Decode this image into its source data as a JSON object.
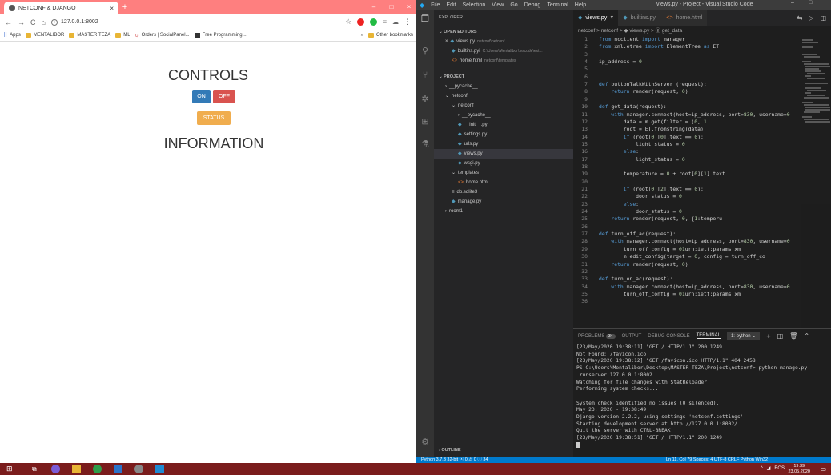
{
  "browser": {
    "tab_title": "NETCONF & DJANGO",
    "url": "127.0.0.1:8002",
    "bookmarks": [
      "Apps",
      "MENTALIBOR",
      "MASTER TEZA",
      "ML",
      "Orders | SocialPanel...",
      "Free Programming..."
    ],
    "bookmarks_more": "»",
    "other_bookmarks": "Other bookmarks",
    "page": {
      "controls_heading": "CONTROLS",
      "on_label": "ON",
      "off_label": "OFF",
      "status_label": "STATUS",
      "info_heading": "INFORMATION"
    }
  },
  "vscode": {
    "menu": [
      "File",
      "Edit",
      "Selection",
      "View",
      "Go",
      "Debug",
      "Terminal",
      "Help"
    ],
    "window_title": "views.py - Project - Visual Studio Code",
    "explorer_title": "EXPLORER",
    "open_editors_title": "OPEN EDITORS",
    "open_editors": [
      {
        "name": "views.py",
        "path": "netconf\\netconf"
      },
      {
        "name": "builtins.pyi",
        "path": "C:\\Users\\Mentalibor\\.vscode\\ext..."
      },
      {
        "name": "home.html",
        "path": "netconf\\templates"
      }
    ],
    "project_title": "PROJECT",
    "tree": [
      "__pycache__",
      "netconf",
      "netconf",
      "__pycache__",
      "__init__.py",
      "settings.py",
      "urls.py",
      "views.py",
      "wsgi.py",
      "templates",
      "home.html",
      "db.sqlite3",
      "manage.py",
      "room1"
    ],
    "outline_title": "OUTLINE",
    "tabs": [
      "views.py",
      "builtins.pyi",
      "home.html"
    ],
    "breadcrumb": "netconf > netconf > ◆ views.py > ⓖ get_data",
    "code": [
      [
        "1",
        "from ncclient import manager"
      ],
      [
        "2",
        "from xml.etree import ElementTree as ET"
      ],
      [
        "3",
        ""
      ],
      [
        "4",
        "ip_address = '10.21.2.53'"
      ],
      [
        "5",
        ""
      ],
      [
        "6",
        ""
      ],
      [
        "7",
        "def buttonTalkWithServer (request):"
      ],
      [
        "8",
        "    return render(request, 'home.html')"
      ],
      [
        "9",
        ""
      ],
      [
        "10",
        "def get_data(request):"
      ],
      [
        "11",
        "    with manager.connect(host=ip_address, port=830, username='"
      ],
      [
        "12",
        "        data = m.get(filter = (\"subtree\", \"<room-data></room-d"
      ],
      [
        "13",
        "        root = ET.fromstring(data)"
      ],
      [
        "14",
        "        if (root[0][0].text == \"false\"):"
      ],
      [
        "15",
        "            light_status = \"Light Status: OFF\""
      ],
      [
        "16",
        "        else:"
      ],
      [
        "17",
        "            light_status = \"Light Status: ON\""
      ],
      [
        "18",
        ""
      ],
      [
        "19",
        "        temperature = \"Temperature: \" + root[0][1].text"
      ],
      [
        "20",
        ""
      ],
      [
        "21",
        "        if (root[0][2].text == \"false\"):"
      ],
      [
        "22",
        "            door_status = \"Door Status: CLOSED\""
      ],
      [
        "23",
        "        else:"
      ],
      [
        "24",
        "            door_status = \"Door Status: OPEN\""
      ],
      [
        "25",
        "    return render(request, 'home.html', {'temperature':temperu"
      ],
      [
        "26",
        ""
      ],
      [
        "27",
        "def turn_off_ac(request):"
      ],
      [
        "28",
        "    with manager.connect(host=ip_address, port=830, username='"
      ],
      [
        "29",
        "        turn_off_config = \"\"\"<config xmlns=\"urn:ietf:params:xm"
      ],
      [
        "30",
        "        m.edit_config(target = 'running', config = turn_off_co"
      ],
      [
        "31",
        "    return render(request, 'home.html')"
      ],
      [
        "32",
        ""
      ],
      [
        "33",
        "def turn_on_ac(request):"
      ],
      [
        "34",
        "    with manager.connect(host=ip_address, port=830, username='"
      ],
      [
        "35",
        "        turn_off_config = \"\"\"<config xmlns=\"urn:ietf:params:xm"
      ],
      [
        "36",
        ""
      ]
    ],
    "panel_tabs": [
      "PROBLEMS",
      "OUTPUT",
      "DEBUG CONSOLE",
      "TERMINAL"
    ],
    "problems_count": "34",
    "terminal_select": "1: python",
    "terminal": [
      "[23/May/2020 19:38:11] \"GET / HTTP/1.1\" 200 1249",
      "Not Found: /favicon.ico",
      "[23/May/2020 19:38:12] \"GET /favicon.ico HTTP/1.1\" 404 2458",
      "PS C:\\Users\\Mentalibor\\Desktop\\MASTER TEZA\\Project\\netconf> python manage.py",
      " runserver 127.0.0.1:8002",
      "Watching for file changes with StatReloader",
      "Performing system checks...",
      "",
      "System check identified no issues (0 silenced).",
      "May 23, 2020 - 19:38:49",
      "Django version 2.2.2, using settings 'netconf.settings'",
      "Starting development server at http://127.0.0.1:8002/",
      "Quit the server with CTRL-BREAK.",
      "[23/May/2020 19:38:51] \"GET / HTTP/1.1\" 200 1249"
    ],
    "status_left": "Python 3.7.3 32-bit   ⓧ 0 ⚠ 0 ⓘ 34",
    "status_right": "Ln 11, Col 79   Spaces: 4   UTF-8   CRLF   Python   Win32"
  },
  "taskbar": {
    "lang": "BOS",
    "time": "19:39",
    "date": "23.05.2020"
  },
  "colors": {
    "chrome_tab": "#fe7f7f",
    "vscode_blue": "#007acc",
    "taskbar": "#7a1c1c"
  }
}
